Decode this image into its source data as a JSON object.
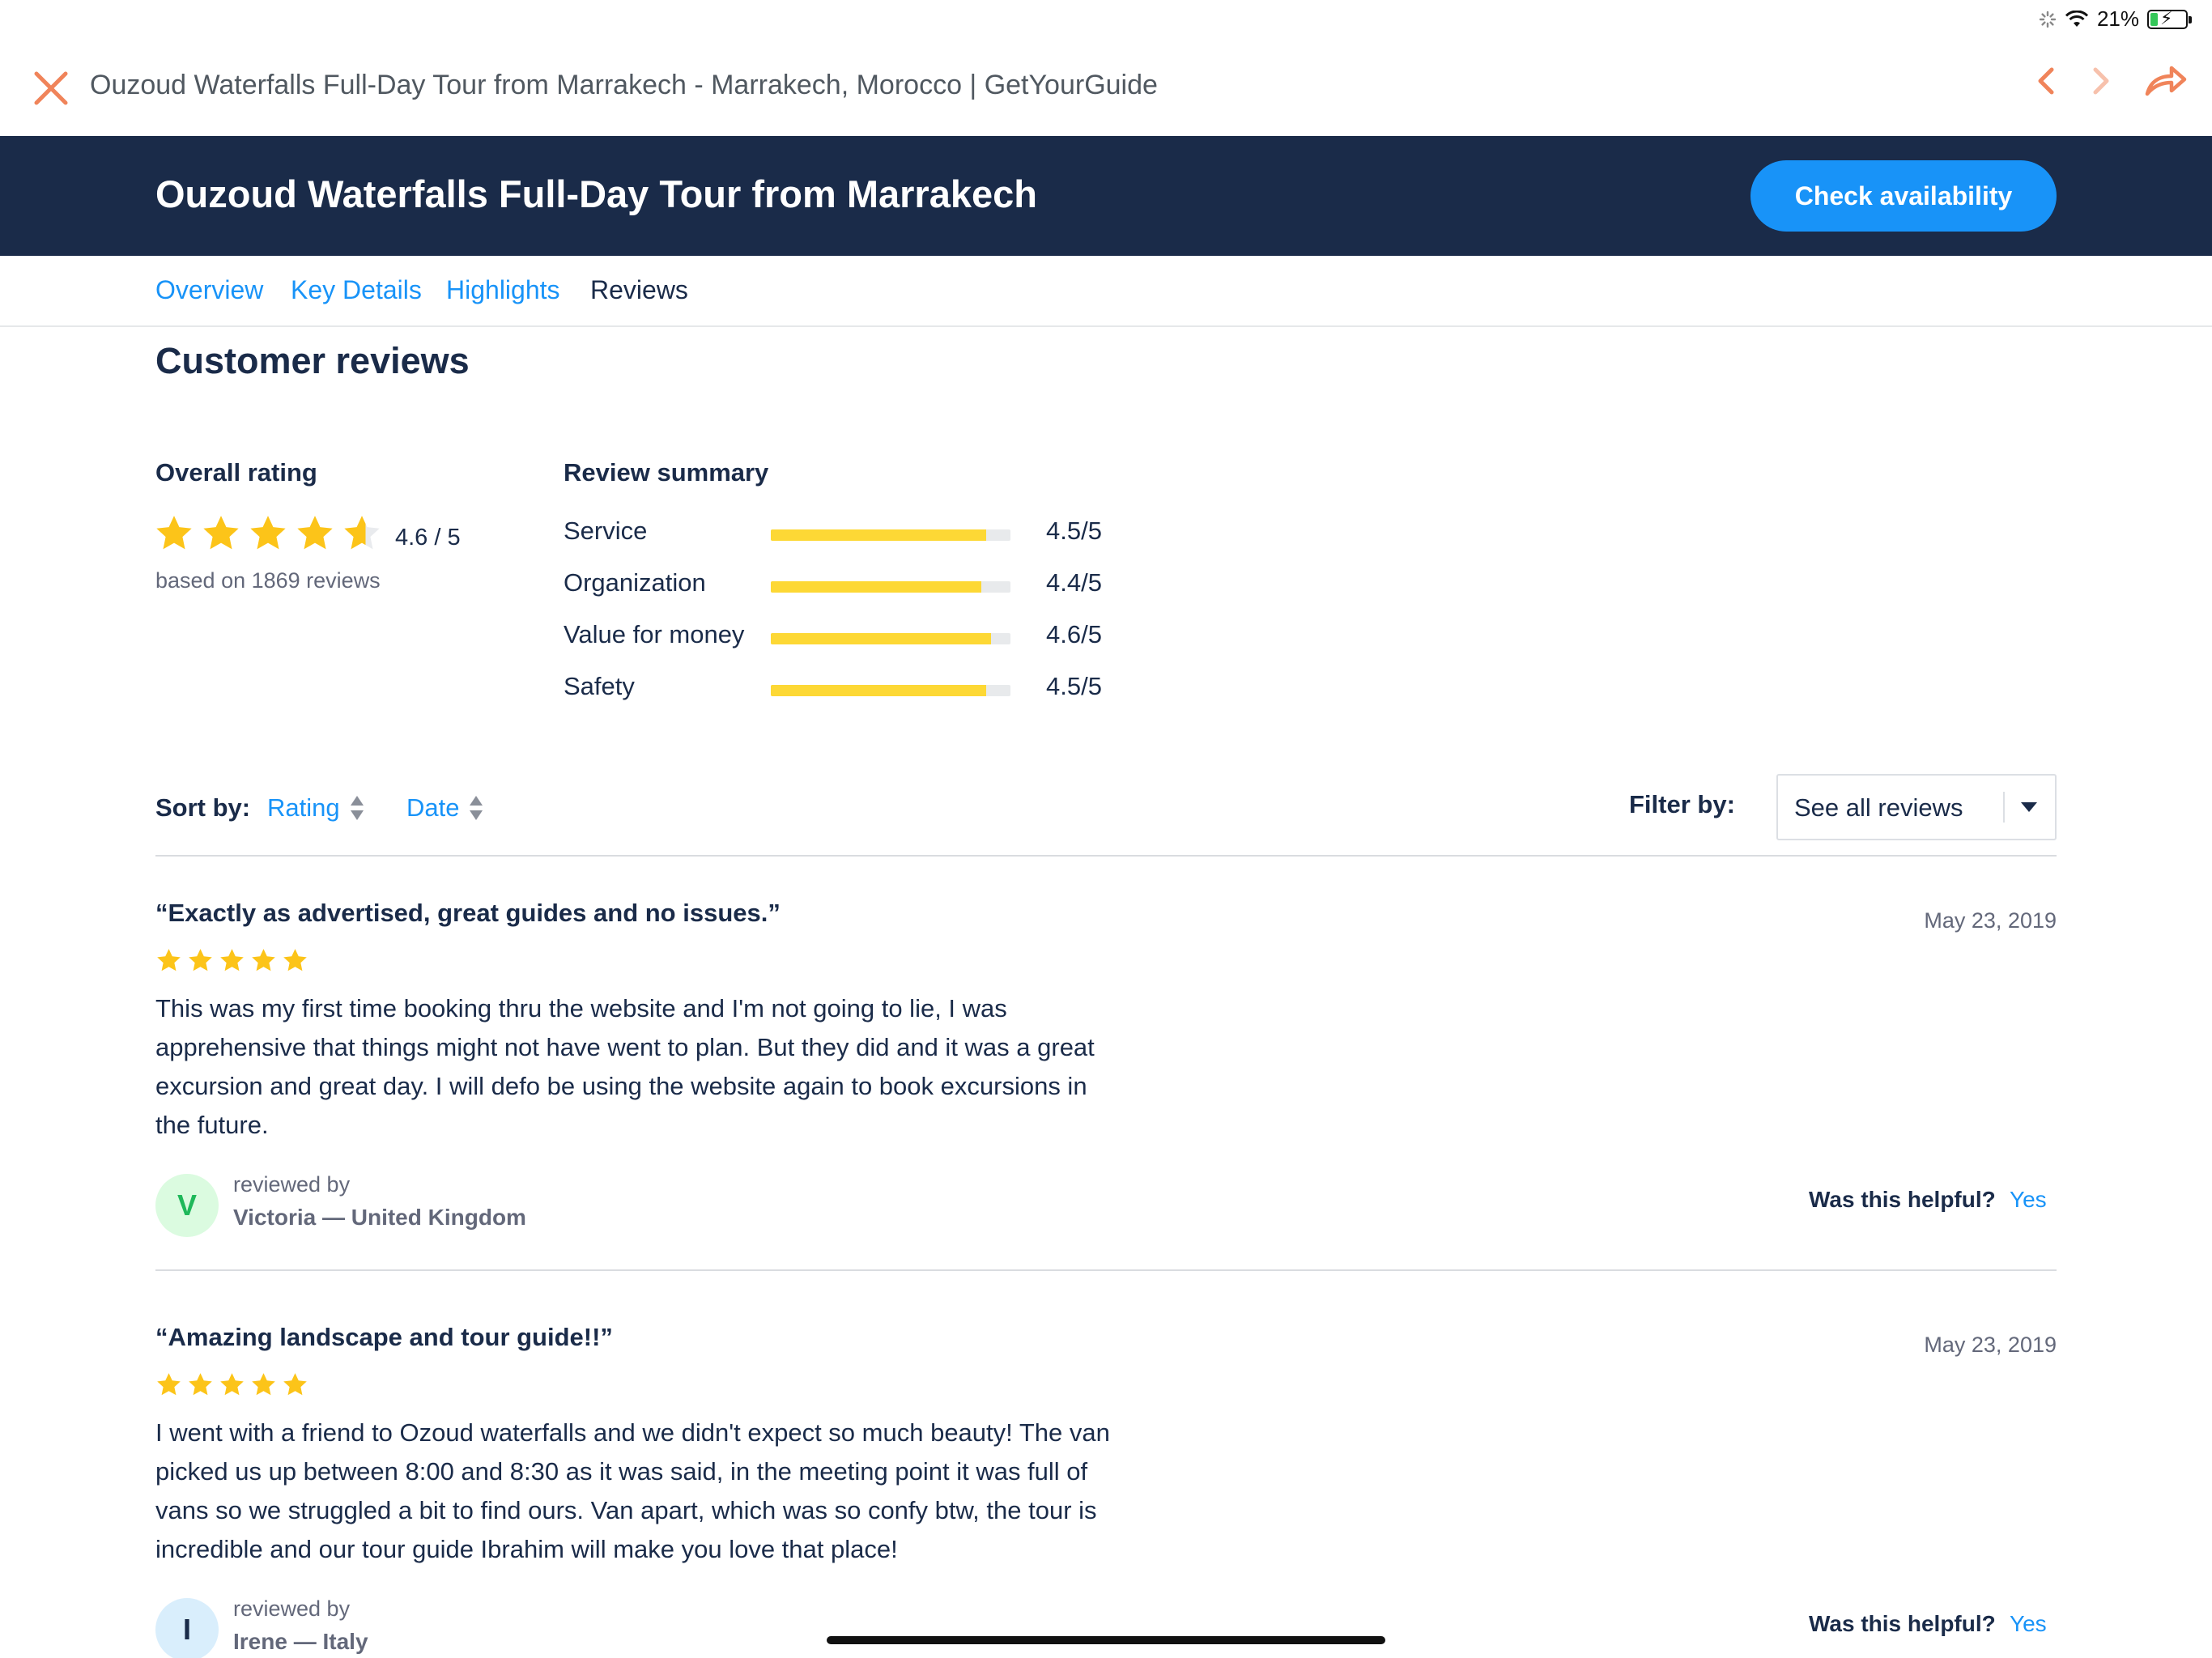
{
  "status_bar": {
    "battery": "21%",
    "battery_level": 0.21
  },
  "browser": {
    "page_title": "Ouzoud Waterfalls Full-Day Tour from Marrakech - Marrakech, Morocco | GetYourGuide",
    "accent_color": "#f0845a"
  },
  "header": {
    "title": "Ouzoud Waterfalls Full-Day Tour from Marrakech",
    "cta_label": "Check availability",
    "background": "#1a2b49",
    "cta_color": "#1893f8"
  },
  "tabs": [
    {
      "label": "Overview",
      "active": false
    },
    {
      "label": "Key Details",
      "active": false
    },
    {
      "label": "Highlights",
      "active": false
    },
    {
      "label": "Reviews",
      "active": true
    }
  ],
  "reviews_section": {
    "title": "Customer reviews",
    "overall": {
      "label": "Overall rating",
      "value_text": "4.6 / 5",
      "value": 4.6,
      "based_on": "based on 1869 reviews"
    },
    "summary": {
      "label": "Review summary",
      "items": [
        {
          "label": "Service",
          "value_text": "4.5/5",
          "value": 4.5
        },
        {
          "label": "Organization",
          "value_text": "4.4/5",
          "value": 4.4
        },
        {
          "label": "Value for money",
          "value_text": "4.6/5",
          "value": 4.6
        },
        {
          "label": "Safety",
          "value_text": "4.5/5",
          "value": 4.5
        }
      ]
    },
    "sort": {
      "label": "Sort by:",
      "options": [
        "Rating",
        "Date"
      ]
    },
    "filter": {
      "label": "Filter by:",
      "selected": "See all reviews"
    }
  },
  "reviews": [
    {
      "title": "“Exactly as advertised, great guides and no issues.”",
      "date": "May 23, 2019",
      "stars": 5,
      "body": "This was my first time booking thru the website and I'm not going to lie, I was apprehensive that things might not have went to plan. But they did and it was a great excursion and great day. I will defo be using the website again to book excursions in the future.",
      "reviewed_by_label": "reviewed by",
      "reviewer": "Victoria — United Kingdom",
      "initial": "V",
      "avatar_bg": "#dbfbe0",
      "avatar_fg": "#1fb85a",
      "helpful_label": "Was this helpful?",
      "yes_label": "Yes"
    },
    {
      "title": "“Amazing landscape and tour guide!!”",
      "date": "May 23, 2019",
      "stars": 5,
      "body": "I went with a friend to Ozoud waterfalls and we didn't expect so much beauty! The van picked us up between 8:00 and 8:30 as it was said, in the meeting point it was full of vans so we struggled a bit to find ours. Van apart, which was so confy btw, the tour is incredible and our tour guide Ibrahim will make you love that place!",
      "reviewed_by_label": "reviewed by",
      "reviewer": "Irene — Italy",
      "initial": "I",
      "avatar_bg": "#d9eefc",
      "avatar_fg": "#1a2b49",
      "helpful_label": "Was this helpful?",
      "yes_label": "Yes"
    }
  ]
}
